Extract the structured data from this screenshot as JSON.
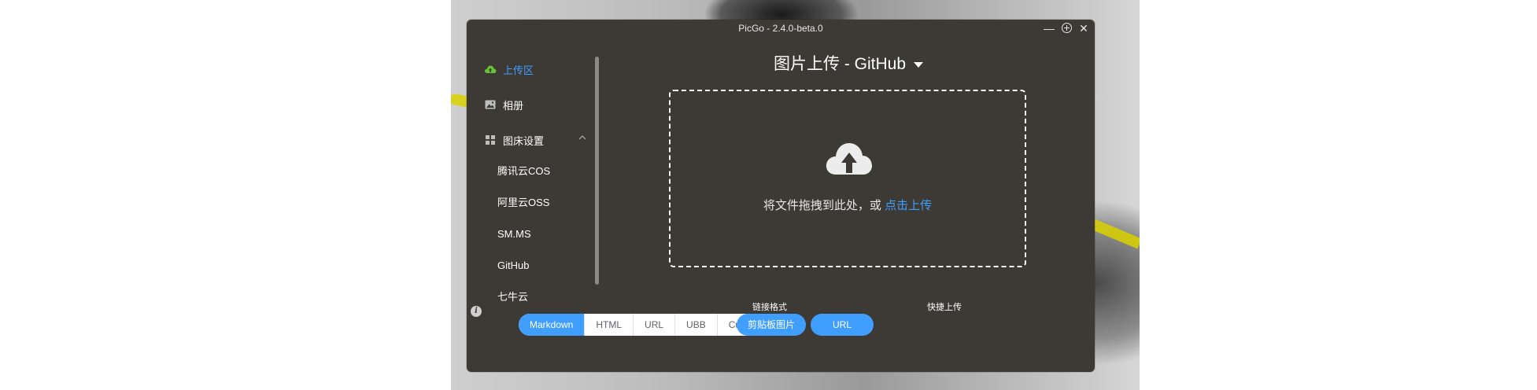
{
  "window": {
    "title": "PicGo - 2.4.0-beta.0",
    "controls": {
      "minimize": "—",
      "close": "✕"
    }
  },
  "sidebar": {
    "items": [
      {
        "label": "上传区",
        "icon": "cloud-upload-icon",
        "active": true
      },
      {
        "label": "相册",
        "icon": "image-icon",
        "active": false
      },
      {
        "label": "图床设置",
        "icon": "grid-icon",
        "active": false,
        "expanded": true
      }
    ],
    "sub_items": [
      "腾讯云COS",
      "阿里云OSS",
      "SM.MS",
      "GitHub",
      "七牛云"
    ],
    "info_icon": "i"
  },
  "main": {
    "title": "图片上传 - GitHub",
    "dropzone": {
      "text": "将文件拖拽到此处，或 ",
      "link": "点击上传"
    },
    "link_format": {
      "label": "链接格式",
      "options": [
        "Markdown",
        "HTML",
        "URL",
        "UBB",
        "Custom"
      ],
      "selected": "Markdown"
    },
    "quick_upload": {
      "label": "快捷上传",
      "buttons": [
        "剪贴板图片",
        "URL"
      ]
    }
  },
  "colors": {
    "accent": "#409eff",
    "active_green": "#67c23a",
    "window_bg": "#3d3a36"
  }
}
